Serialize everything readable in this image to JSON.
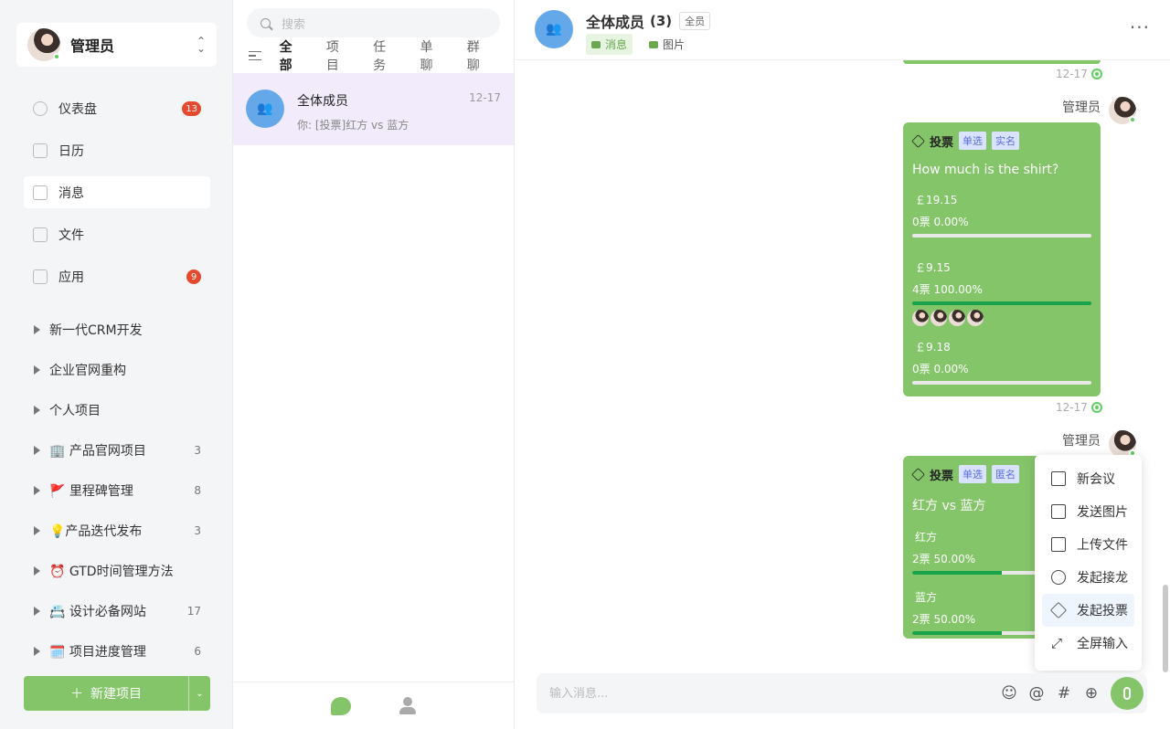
{
  "sidebar": {
    "user": {
      "name": "管理员"
    },
    "nav": [
      {
        "label": "仪表盘",
        "badge": "13",
        "icon": "dashboard-icon"
      },
      {
        "label": "日历",
        "badge": "",
        "icon": "calendar-icon"
      },
      {
        "label": "消息",
        "badge": "",
        "icon": "message-icon"
      },
      {
        "label": "文件",
        "badge": "",
        "icon": "file-icon"
      },
      {
        "label": "应用",
        "badge": "9",
        "icon": "apps-icon"
      }
    ],
    "projects": [
      {
        "name": "新一代CRM开发",
        "count": ""
      },
      {
        "name": "企业官网重构",
        "count": ""
      },
      {
        "name": "个人项目",
        "count": ""
      },
      {
        "name": "🏢 产品官网项目",
        "count": "3"
      },
      {
        "name": "🚩 里程碑管理",
        "count": "8"
      },
      {
        "name": "💡产品迭代发布",
        "count": "3"
      },
      {
        "name": "⏰ GTD时间管理方法",
        "count": ""
      },
      {
        "name": "📇 设计必备网站",
        "count": "17"
      },
      {
        "name": "🗓️ 项目进度管理",
        "count": "6"
      }
    ],
    "new_project": "新建项目"
  },
  "dialogs": {
    "search_placeholder": "搜索",
    "tabs": [
      "全部",
      "项目",
      "任务",
      "单聊",
      "群聊"
    ],
    "items": [
      {
        "title": "全体成员",
        "time": "12-17",
        "preview": "你: [投票]红方 vs 蓝方"
      }
    ]
  },
  "chat": {
    "title": "全体成员",
    "count": "(3)",
    "tag": "全员",
    "filters": [
      "消息",
      "图片"
    ],
    "more": "···",
    "messages": [
      {
        "time": "12-17"
      },
      {
        "sender": "管理员",
        "vote_label": "投票",
        "pills": [
          "单选",
          "实名"
        ],
        "question": "How much is the shirt?",
        "options": [
          {
            "label": "￡19.15",
            "stat": "0票   0.00%",
            "pct": 0
          },
          {
            "label": "￡9.15",
            "stat": "4票   100.00%",
            "pct": 100
          },
          {
            "label": "￡9.18",
            "stat": "0票   0.00%",
            "pct": 0
          }
        ],
        "time": "12-17"
      },
      {
        "sender": "管理员",
        "vote_label": "投票",
        "pills": [
          "单选",
          "匿名"
        ],
        "question": "红方 vs 蓝方",
        "options": [
          {
            "label": "红方",
            "stat": "2票   50.00%",
            "pct": 50
          },
          {
            "label": "蓝方",
            "stat": "2票   50.00%",
            "pct": 50
          }
        ]
      }
    ],
    "menu": [
      "新会议",
      "发送图片",
      "上传文件",
      "发起接龙",
      "发起投票",
      "全屏输入"
    ],
    "input_placeholder": "输入消息..."
  }
}
